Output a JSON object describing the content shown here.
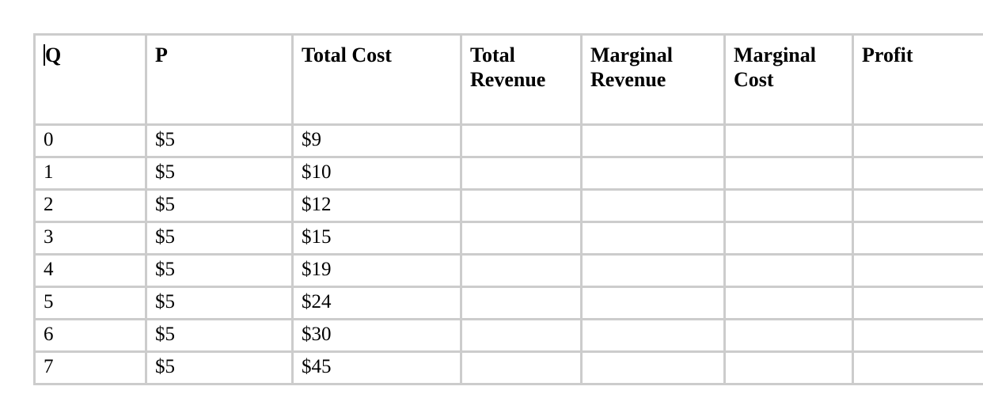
{
  "table": {
    "columns": [
      {
        "key": "q",
        "label": "Q",
        "class": "col-q",
        "has_caret": true
      },
      {
        "key": "p",
        "label": "P",
        "class": "col-p",
        "has_caret": false
      },
      {
        "key": "tc",
        "label": "Total Cost",
        "class": "col-tc",
        "has_caret": false
      },
      {
        "key": "tr",
        "label": "Total Revenue",
        "class": "col-tr",
        "has_caret": false
      },
      {
        "key": "mr",
        "label": "Marginal Revenue",
        "class": "col-mr",
        "has_caret": false
      },
      {
        "key": "mc",
        "label": "Marginal Cost",
        "class": "col-mc",
        "has_caret": false
      },
      {
        "key": "pr",
        "label": "Profit",
        "class": "col-pr",
        "has_caret": false
      }
    ],
    "rows": [
      {
        "q": "0",
        "p": "$5",
        "tc": "$9",
        "tr": "",
        "mr": "",
        "mc": "",
        "pr": ""
      },
      {
        "q": "1",
        "p": "$5",
        "tc": "$10",
        "tr": "",
        "mr": "",
        "mc": "",
        "pr": ""
      },
      {
        "q": "2",
        "p": "$5",
        "tc": "$12",
        "tr": "",
        "mr": "",
        "mc": "",
        "pr": ""
      },
      {
        "q": "3",
        "p": "$5",
        "tc": "$15",
        "tr": "",
        "mr": "",
        "mc": "",
        "pr": ""
      },
      {
        "q": "4",
        "p": "$5",
        "tc": "$19",
        "tr": "",
        "mr": "",
        "mc": "",
        "pr": ""
      },
      {
        "q": "5",
        "p": "$5",
        "tc": "$24",
        "tr": "",
        "mr": "",
        "mc": "",
        "pr": ""
      },
      {
        "q": "6",
        "p": "$5",
        "tc": "$30",
        "tr": "",
        "mr": "",
        "mc": "",
        "pr": ""
      },
      {
        "q": "7",
        "p": "$5",
        "tc": "$45",
        "tr": "",
        "mr": "",
        "mc": "",
        "pr": ""
      }
    ],
    "colors": {
      "border": "#cccccc",
      "background": "#ffffff",
      "text": "#000000",
      "caret": "#000000"
    }
  }
}
